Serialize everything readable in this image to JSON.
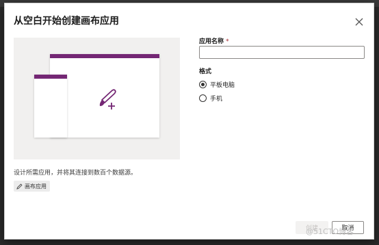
{
  "dialog": {
    "title": "从空白开始创建画布应用",
    "close_icon": "close-icon"
  },
  "preview": {
    "accent": "#742774",
    "icon": "brush-plus-icon"
  },
  "description": "设计所需应用，并将其连接到数百个数据源。",
  "tag": {
    "icon": "pencil-icon",
    "label": "画布应用"
  },
  "form": {
    "app_name_label": "应用名称",
    "required_mark": "*",
    "app_name_value": "",
    "format_label": "格式",
    "options": [
      {
        "label": "平板电脑",
        "selected": true
      },
      {
        "label": "手机",
        "selected": false
      }
    ]
  },
  "buttons": {
    "create": "创建",
    "cancel": "取消"
  },
  "watermark": "@51CTO博客"
}
